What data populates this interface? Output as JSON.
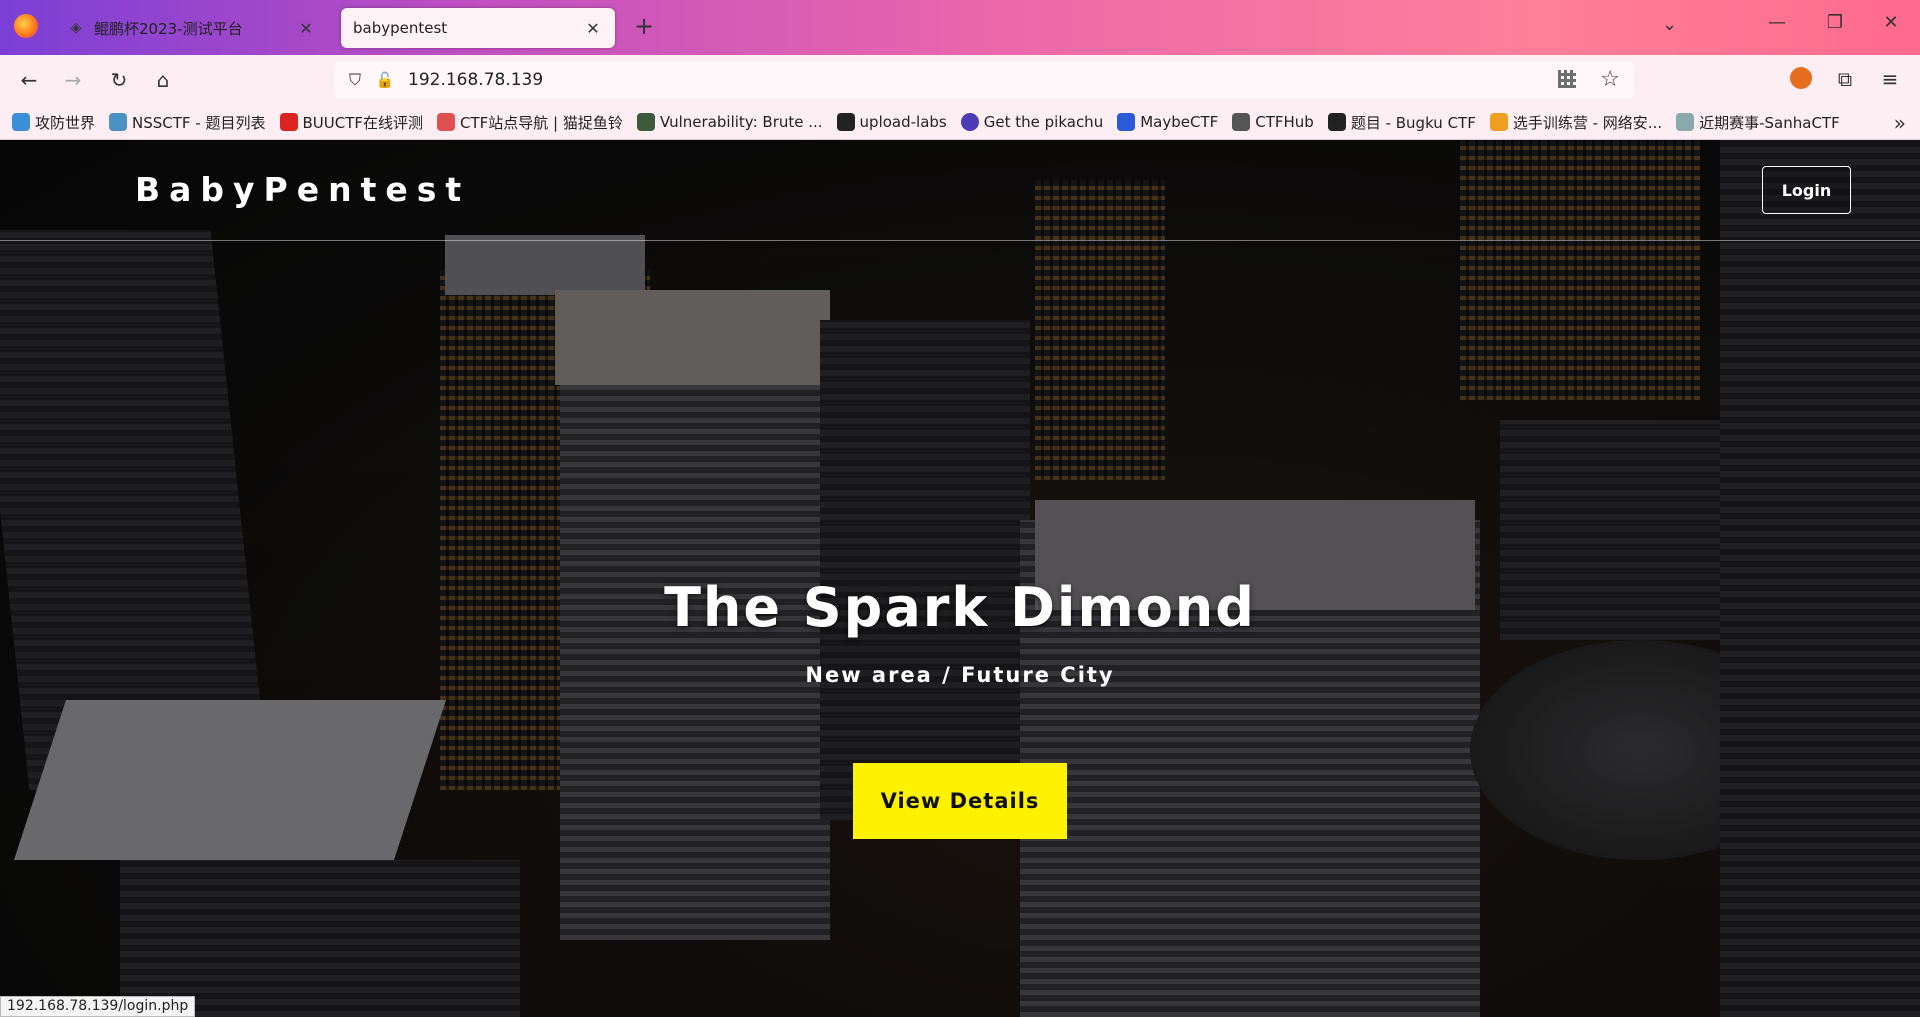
{
  "browser": {
    "tabs": [
      {
        "title": "鲲鹏杯2023-测试平台",
        "active": false
      },
      {
        "title": "babypentest",
        "active": true
      }
    ],
    "url": "192.168.78.139",
    "bookmarks": [
      {
        "label": "攻防世界",
        "color": "#3a8fd8"
      },
      {
        "label": "NSSCTF - 题目列表",
        "color": "#4a90c0"
      },
      {
        "label": "BUUCTF在线评测",
        "color": "#d22"
      },
      {
        "label": "CTF站点导航 | 猫捉鱼铃",
        "color": "#e05050"
      },
      {
        "label": "Vulnerability: Brute ...",
        "color": "#3d5a3d"
      },
      {
        "label": "upload-labs",
        "color": "#222"
      },
      {
        "label": "Get the pikachu",
        "color": "#4b3bb5"
      },
      {
        "label": "MaybeCTF",
        "color": "#2a5ad8"
      },
      {
        "label": "CTFHub",
        "color": "#555"
      },
      {
        "label": "题目 - Bugku CTF",
        "color": "#222"
      },
      {
        "label": "选手训练营 - 网络安...",
        "color": "#f0a020"
      },
      {
        "label": "近期赛事-SanhaCTF",
        "color": "#8aa"
      }
    ],
    "status_url": "192.168.78.139/login.php"
  },
  "site": {
    "brand": "BabyPentest",
    "login_label": "Login",
    "hero_title": "The Spark Dimond",
    "hero_subtitle": "New area / Future City",
    "hero_button": "View Details"
  },
  "colors": {
    "accent_button": "#fff200",
    "tabbar_gradient_start": "#7b3fd6",
    "tabbar_gradient_end": "#ff6a8e"
  }
}
